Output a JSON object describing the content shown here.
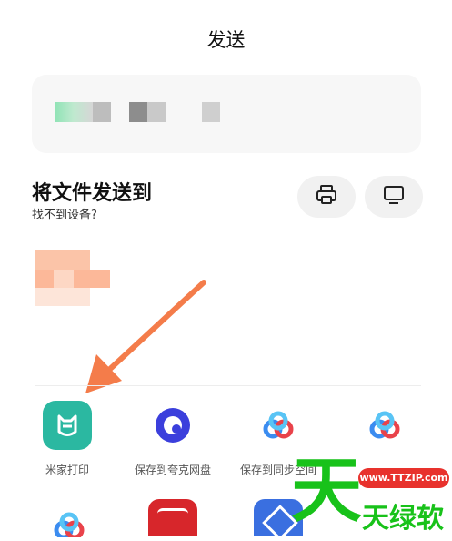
{
  "header": {
    "title": "发送"
  },
  "section": {
    "title": "将文件发送到",
    "help_link": "找不到设备?"
  },
  "actions": {
    "print_icon": "printer-icon",
    "screen_icon": "monitor-icon"
  },
  "apps": [
    {
      "label": "米家打印",
      "icon": "mijia-icon",
      "color": "#2bb8a1"
    },
    {
      "label": "保存到夸克网盘",
      "icon": "quark-icon",
      "color": "#3b3fdc"
    },
    {
      "label": "保存到同步空间",
      "icon": "baidu-cloud-icon",
      "color": "#3b8cf0"
    },
    {
      "label": "",
      "icon": "baidu-cloud-icon",
      "color": "#3b8cf0"
    }
  ],
  "watermark": {
    "url": "www.TTZIP.com",
    "big_char": "天",
    "small_text": "天绿软"
  },
  "colors": {
    "arrow": "#f47c4a",
    "card_bg": "#f7f7f7",
    "pill_bg": "#f1f1f1"
  }
}
